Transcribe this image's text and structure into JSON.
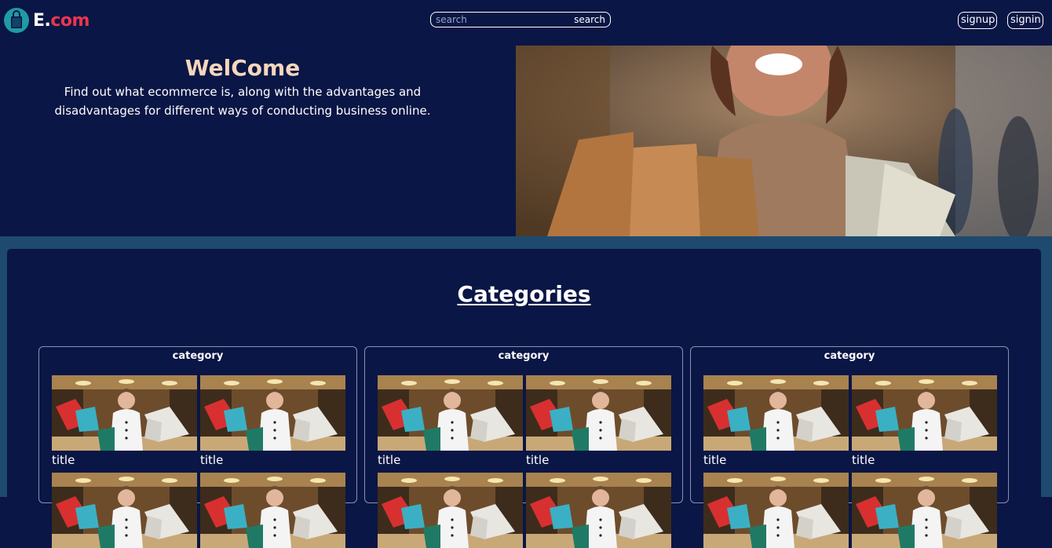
{
  "header": {
    "logo_e": "E.",
    "logo_com": "com",
    "search": {
      "placeholder": "search",
      "button_label": "search"
    },
    "signup_label": "signup",
    "signin_label": "signin"
  },
  "hero": {
    "title": "WelCome",
    "text": "Find out what ecommerce is, along with the advantages and disadvantages for different ways of conducting business online."
  },
  "categories": {
    "heading": "Categories",
    "cards": [
      {
        "label": "category",
        "items": [
          {
            "title": "title"
          },
          {
            "title": "title"
          },
          {
            "title": ""
          },
          {
            "title": ""
          }
        ]
      },
      {
        "label": "category",
        "items": [
          {
            "title": "title"
          },
          {
            "title": "title"
          },
          {
            "title": ""
          },
          {
            "title": ""
          }
        ]
      },
      {
        "label": "category",
        "items": [
          {
            "title": "title"
          },
          {
            "title": "title"
          },
          {
            "title": ""
          },
          {
            "title": ""
          }
        ]
      }
    ]
  },
  "colors": {
    "background": "#0a1645",
    "band": "#1e4a70",
    "accent": "#e9364f",
    "hero_title": "#f6d7bd",
    "logo_circle": "#1f9aa6"
  },
  "icons": [
    "shopping-bag-icon"
  ]
}
